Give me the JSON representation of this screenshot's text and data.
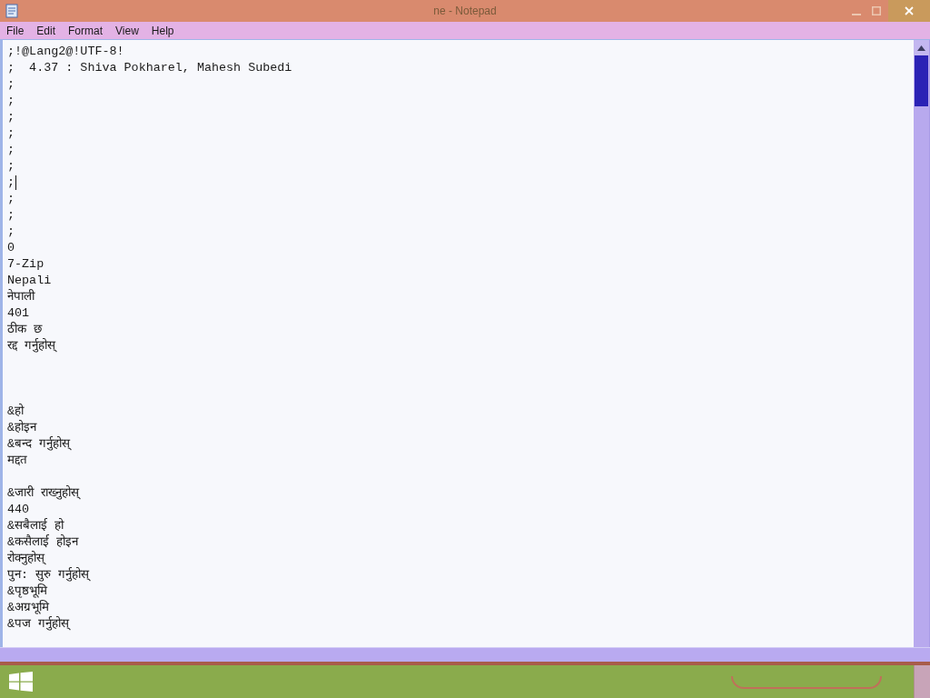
{
  "window": {
    "title": "ne - Notepad"
  },
  "menu": [
    "File",
    "Edit",
    "Format",
    "View",
    "Help"
  ],
  "editor": {
    "lines": [
      {
        "kind": "text",
        "text": ";!@Lang2@!UTF-8!",
        "caret": false
      },
      {
        "kind": "text",
        "text": ";  4.37 : Shiva Pokharel, Mahesh Subedi",
        "caret": false
      },
      {
        "kind": "text",
        "text": ";",
        "caret": false
      },
      {
        "kind": "text",
        "text": ";",
        "caret": false
      },
      {
        "kind": "text",
        "text": ";",
        "caret": false
      },
      {
        "kind": "text",
        "text": ";",
        "caret": false
      },
      {
        "kind": "text",
        "text": ";",
        "caret": false
      },
      {
        "kind": "text",
        "text": ";",
        "caret": false
      },
      {
        "kind": "text",
        "text": ";",
        "caret": true
      },
      {
        "kind": "text",
        "text": ";",
        "caret": false
      },
      {
        "kind": "text",
        "text": ";",
        "caret": false
      },
      {
        "kind": "text",
        "text": ";",
        "caret": false
      },
      {
        "kind": "text",
        "text": "0",
        "caret": false
      },
      {
        "kind": "text",
        "text": "7-Zip",
        "caret": false
      },
      {
        "kind": "text",
        "text": "Nepali",
        "caret": false
      },
      {
        "kind": "text",
        "text": "नेपाली",
        "caret": false
      },
      {
        "kind": "text",
        "text": "401",
        "caret": false
      },
      {
        "kind": "text",
        "text": "ठीक छ",
        "caret": false
      },
      {
        "kind": "text",
        "text": "रद्द गर्नुहोस्",
        "caret": false
      },
      {
        "kind": "blank",
        "caret": false
      },
      {
        "kind": "blank",
        "caret": false
      },
      {
        "kind": "blank",
        "caret": false
      },
      {
        "kind": "text",
        "text": "&हो",
        "caret": false
      },
      {
        "kind": "text",
        "text": "&होइन",
        "caret": false
      },
      {
        "kind": "text",
        "text": "&बन्द गर्नुहोस्",
        "caret": false
      },
      {
        "kind": "text",
        "text": "मद्दत",
        "caret": false
      },
      {
        "kind": "blank",
        "caret": false
      },
      {
        "kind": "text",
        "text": "&जारी राख्नुहोस्",
        "caret": false
      },
      {
        "kind": "text",
        "text": "440",
        "caret": false
      },
      {
        "kind": "text",
        "text": "&सबैलाई हो",
        "caret": false
      },
      {
        "kind": "text",
        "text": "&कसैलाई होइन",
        "caret": false
      },
      {
        "kind": "text",
        "text": "रोक्नुहोस्",
        "caret": false
      },
      {
        "kind": "text",
        "text": "पुन: सुरु गर्नुहोस्",
        "caret": false
      },
      {
        "kind": "text",
        "text": "&पृष्ठभूमि",
        "caret": false
      },
      {
        "kind": "text",
        "text": "&अग्रभूमि",
        "caret": false
      },
      {
        "kind": "text",
        "text": "&पज गर्नुहोस्",
        "caret": false
      }
    ]
  }
}
